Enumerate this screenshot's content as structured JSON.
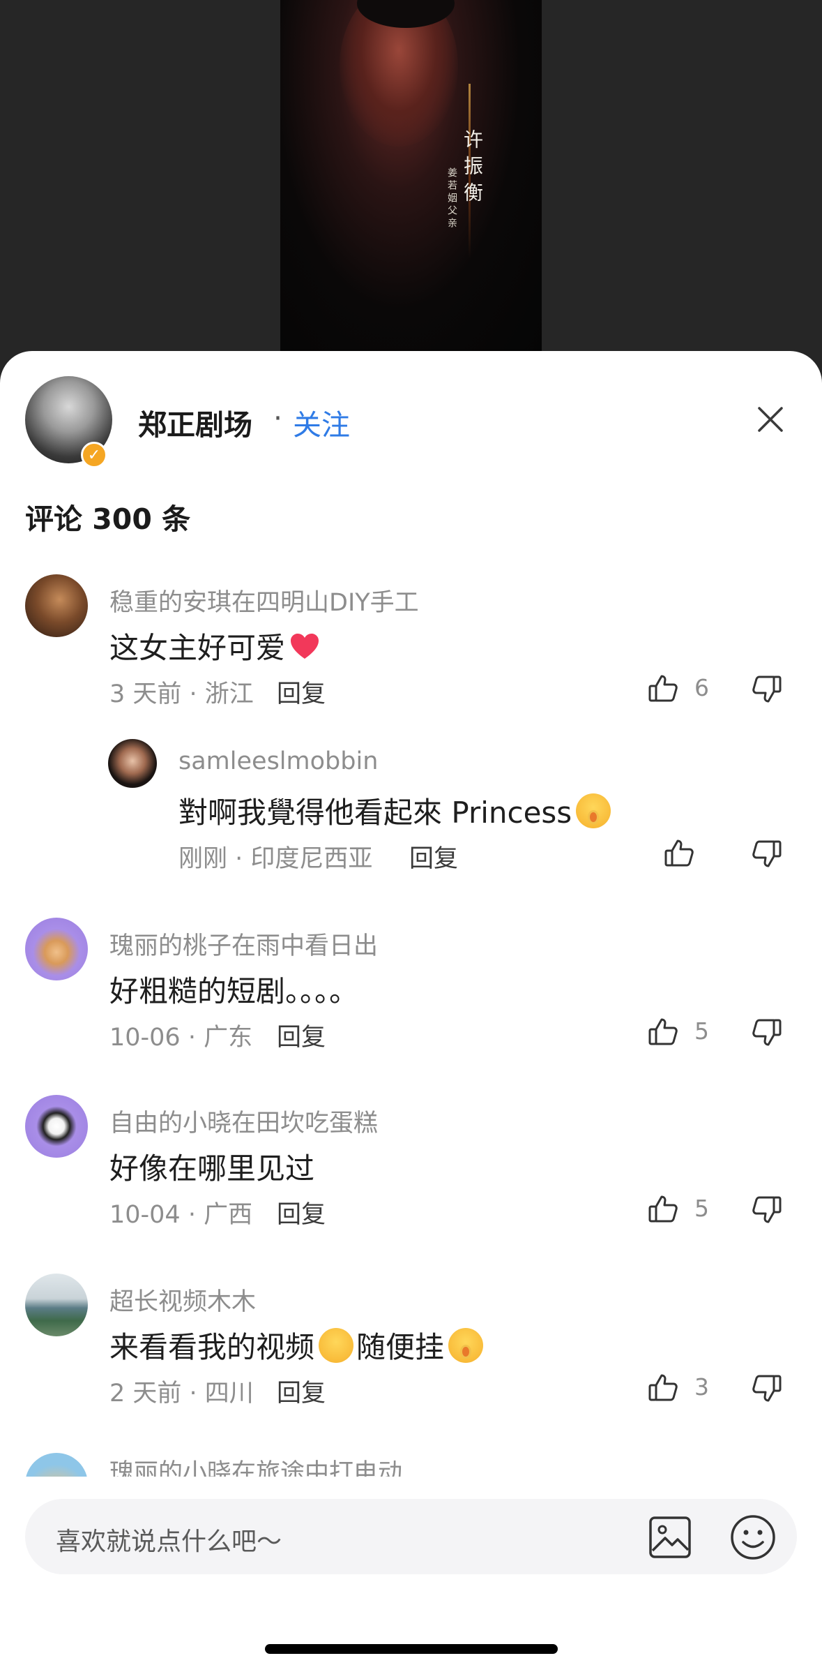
{
  "video": {
    "overlay_name": "许振衡",
    "overlay_role": "姜若姻父亲"
  },
  "header": {
    "author_name": "郑正剧场",
    "separator": "·",
    "follow_label": "关注",
    "comments_title": "评论 300 条"
  },
  "comments": [
    {
      "user": "稳重的安琪在四明山DIY手工",
      "text": "这女主好可爱",
      "meta": "3 天前 · 浙江",
      "reply_label": "回复",
      "likes": "6"
    },
    {
      "user": "samleeslmobbin",
      "text": "對啊我覺得他看起來 Princess",
      "meta": "刚刚 · 印度尼西亚",
      "reply_label": "回复",
      "likes": ""
    },
    {
      "user": "瑰丽的桃子在雨中看日出",
      "text": "好粗糙的短剧。。。。",
      "meta": "10-06 · 广东",
      "reply_label": "回复",
      "likes": "5"
    },
    {
      "user": "自由的小晓在田坎吃蛋糕",
      "text": "好像在哪里见过",
      "meta": "10-04 · 广西",
      "reply_label": "回复",
      "likes": "5"
    },
    {
      "user": "超长视频木木",
      "text_part1": "来看看我的视频",
      "text_part2": "随便挂",
      "meta": "2 天前 · 四川",
      "reply_label": "回复",
      "likes": "3"
    },
    {
      "user": "瑰丽的小晓在旅途中打电动"
    }
  ],
  "input": {
    "placeholder": "喜欢就说点什么吧～"
  },
  "icons": {
    "close": "close-icon",
    "like": "thumbs-up-icon",
    "dislike": "thumbs-down-icon",
    "image": "image-icon",
    "emoji": "smiley-icon"
  },
  "colors": {
    "accent": "#2f7be6",
    "badge": "#f5a623",
    "secondary_text": "#8d8d8d"
  }
}
